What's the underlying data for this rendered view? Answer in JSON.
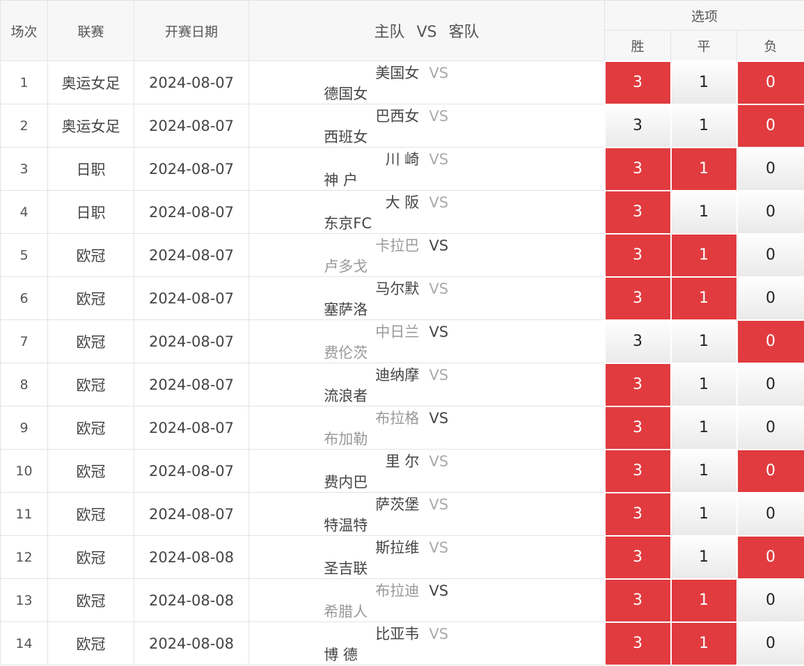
{
  "header": {
    "col_idx": "场次",
    "col_league": "联赛",
    "col_date": "开赛日期",
    "col_home": "主队",
    "col_vs": "VS",
    "col_away": "客队",
    "options_label": "选项",
    "opt_win": "胜",
    "opt_draw": "平",
    "opt_lose": "负"
  },
  "colors": {
    "selected": "#e13b3f",
    "vs_light": "#aaaaaa",
    "dim_team": "#999999"
  },
  "rows": [
    {
      "idx": "1",
      "league": "奥运女足",
      "date": "2024-08-07",
      "home": "美国女",
      "vs": "VS",
      "away": "德国女",
      "dim": false,
      "win": "3",
      "draw": "1",
      "lose": "0",
      "sel": [
        true,
        false,
        true
      ]
    },
    {
      "idx": "2",
      "league": "奥运女足",
      "date": "2024-08-07",
      "home": "巴西女",
      "vs": "VS",
      "away": "西班女",
      "dim": false,
      "win": "3",
      "draw": "1",
      "lose": "0",
      "sel": [
        false,
        false,
        true
      ]
    },
    {
      "idx": "3",
      "league": "日职",
      "date": "2024-08-07",
      "home": "川 崎",
      "vs": "VS",
      "away": "神 户",
      "dim": false,
      "win": "3",
      "draw": "1",
      "lose": "0",
      "sel": [
        true,
        true,
        false
      ]
    },
    {
      "idx": "4",
      "league": "日职",
      "date": "2024-08-07",
      "home": "大 阪",
      "vs": "VS",
      "away": "东京FC",
      "dim": false,
      "win": "3",
      "draw": "1",
      "lose": "0",
      "sel": [
        true,
        false,
        false
      ]
    },
    {
      "idx": "5",
      "league": "欧冠",
      "date": "2024-08-07",
      "home": "卡拉巴",
      "vs": "VS",
      "away": "卢多戈",
      "dim": true,
      "win": "3",
      "draw": "1",
      "lose": "0",
      "sel": [
        true,
        true,
        false
      ]
    },
    {
      "idx": "6",
      "league": "欧冠",
      "date": "2024-08-07",
      "home": "马尔默",
      "vs": "VS",
      "away": "塞萨洛",
      "dim": false,
      "win": "3",
      "draw": "1",
      "lose": "0",
      "sel": [
        true,
        true,
        false
      ]
    },
    {
      "idx": "7",
      "league": "欧冠",
      "date": "2024-08-07",
      "home": "中日兰",
      "vs": "VS",
      "away": "费伦茨",
      "dim": true,
      "win": "3",
      "draw": "1",
      "lose": "0",
      "sel": [
        false,
        false,
        true
      ]
    },
    {
      "idx": "8",
      "league": "欧冠",
      "date": "2024-08-07",
      "home": "迪纳摩",
      "vs": "VS",
      "away": "流浪者",
      "dim": false,
      "win": "3",
      "draw": "1",
      "lose": "0",
      "sel": [
        true,
        false,
        false
      ]
    },
    {
      "idx": "9",
      "league": "欧冠",
      "date": "2024-08-07",
      "home": "布拉格",
      "vs": "VS",
      "away": "布加勒",
      "dim": true,
      "win": "3",
      "draw": "1",
      "lose": "0",
      "sel": [
        true,
        false,
        false
      ]
    },
    {
      "idx": "10",
      "league": "欧冠",
      "date": "2024-08-07",
      "home": "里 尔",
      "vs": "VS",
      "away": "费内巴",
      "dim": false,
      "win": "3",
      "draw": "1",
      "lose": "0",
      "sel": [
        true,
        false,
        true
      ]
    },
    {
      "idx": "11",
      "league": "欧冠",
      "date": "2024-08-07",
      "home": "萨茨堡",
      "vs": "VS",
      "away": "特温特",
      "dim": false,
      "win": "3",
      "draw": "1",
      "lose": "0",
      "sel": [
        true,
        false,
        false
      ]
    },
    {
      "idx": "12",
      "league": "欧冠",
      "date": "2024-08-08",
      "home": "斯拉维",
      "vs": "VS",
      "away": "圣吉联",
      "dim": false,
      "win": "3",
      "draw": "1",
      "lose": "0",
      "sel": [
        true,
        false,
        true
      ]
    },
    {
      "idx": "13",
      "league": "欧冠",
      "date": "2024-08-08",
      "home": "布拉迪",
      "vs": "VS",
      "away": "希腊人",
      "dim": true,
      "win": "3",
      "draw": "1",
      "lose": "0",
      "sel": [
        true,
        true,
        false
      ]
    },
    {
      "idx": "14",
      "league": "欧冠",
      "date": "2024-08-08",
      "home": "比亚韦",
      "vs": "VS",
      "away": "博 德",
      "dim": false,
      "win": "3",
      "draw": "1",
      "lose": "0",
      "sel": [
        true,
        true,
        false
      ]
    }
  ]
}
